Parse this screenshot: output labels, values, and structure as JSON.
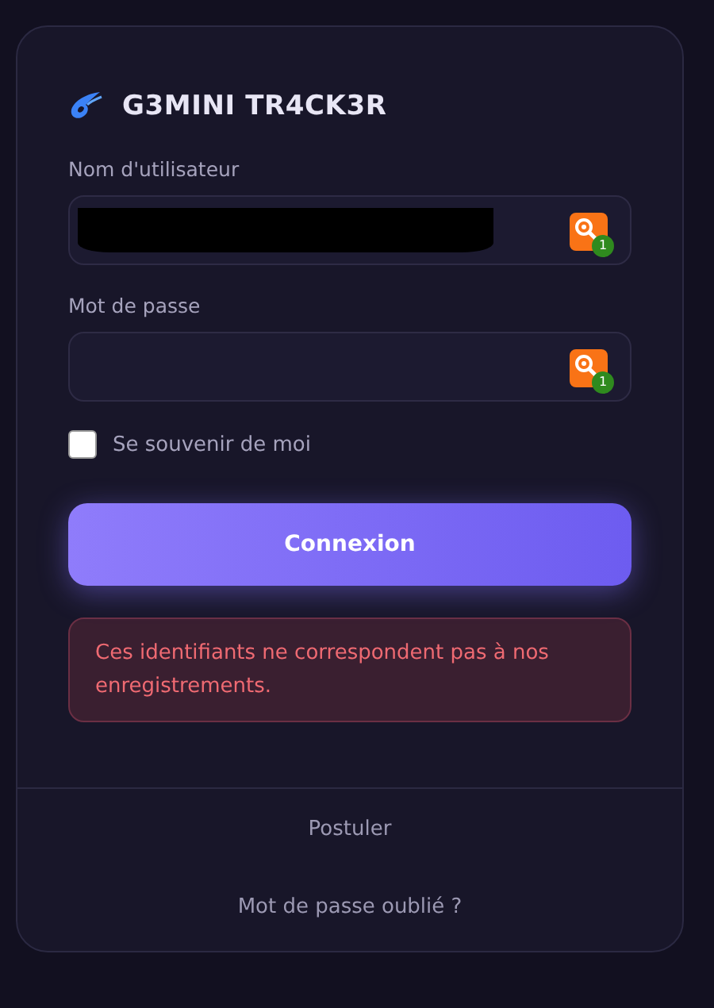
{
  "brand": {
    "title": "G3MINI TR4CK3R"
  },
  "fields": [
    {
      "label": "Nom d'utilisateur",
      "redacted": true,
      "badge": "1"
    },
    {
      "label": "Mot de passe",
      "redacted": false,
      "badge": "1"
    }
  ],
  "remember": {
    "label": "Se souvenir de moi",
    "checked": false
  },
  "submit": {
    "label": "Connexion"
  },
  "error": {
    "message": "Ces identifiants ne correspondent pas à nos enregistrements."
  },
  "links": [
    "Postuler",
    "Mot de passe oublié ?"
  ]
}
